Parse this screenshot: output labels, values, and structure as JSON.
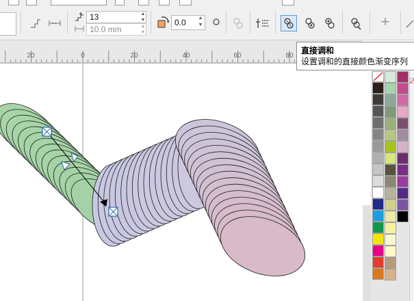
{
  "toolbar": {
    "steps_value": "13",
    "spacing_value": "10.0 mm",
    "rotation_value": "0.0",
    "plus_label": "+"
  },
  "ruler": {
    "ticks": [
      "20",
      "0",
      "20",
      "40",
      "60",
      "80"
    ]
  },
  "tooltip": {
    "title": "直接调和",
    "description": "设置调和的直接颜色渐变序列"
  },
  "palette": {
    "columns": [
      [
        "#2a1f1a",
        "#3e3a37",
        "#555555",
        "#6e6e6e",
        "#858585",
        "#999999",
        "#b0b0b0",
        "#c6c6c6",
        "#dddddd",
        "#ffffff",
        "#1f2a8a",
        "#1aa0e0",
        "#0f9a4a",
        "#f3e600",
        "#e8008a",
        "#e53d2a",
        "#d97a1e"
      ],
      [
        "#d6ead8",
        "#a6d3b0",
        "#8fa898",
        "#7e9a78",
        "#9bb07a",
        "#b6c780",
        "#a7c41e",
        "#d6e67a",
        "#595240",
        "#8c8673",
        "#b8b39b",
        "#d4cf8a",
        "#ece9a6",
        "#f6f3a0",
        "#fafad2",
        "#fff7c8",
        "#b89a7a",
        "#d7b28a"
      ],
      [
        "#a4306a",
        "#c44a8d",
        "#d06aa6",
        "#e7a7c6",
        "#7a4f6e",
        "#a08da3",
        "#d8b3c8",
        "#6b2e6b",
        "#7a2d88",
        "#9b3aa1",
        "#552a84",
        "#7b55a3",
        "#000000"
      ]
    ]
  }
}
